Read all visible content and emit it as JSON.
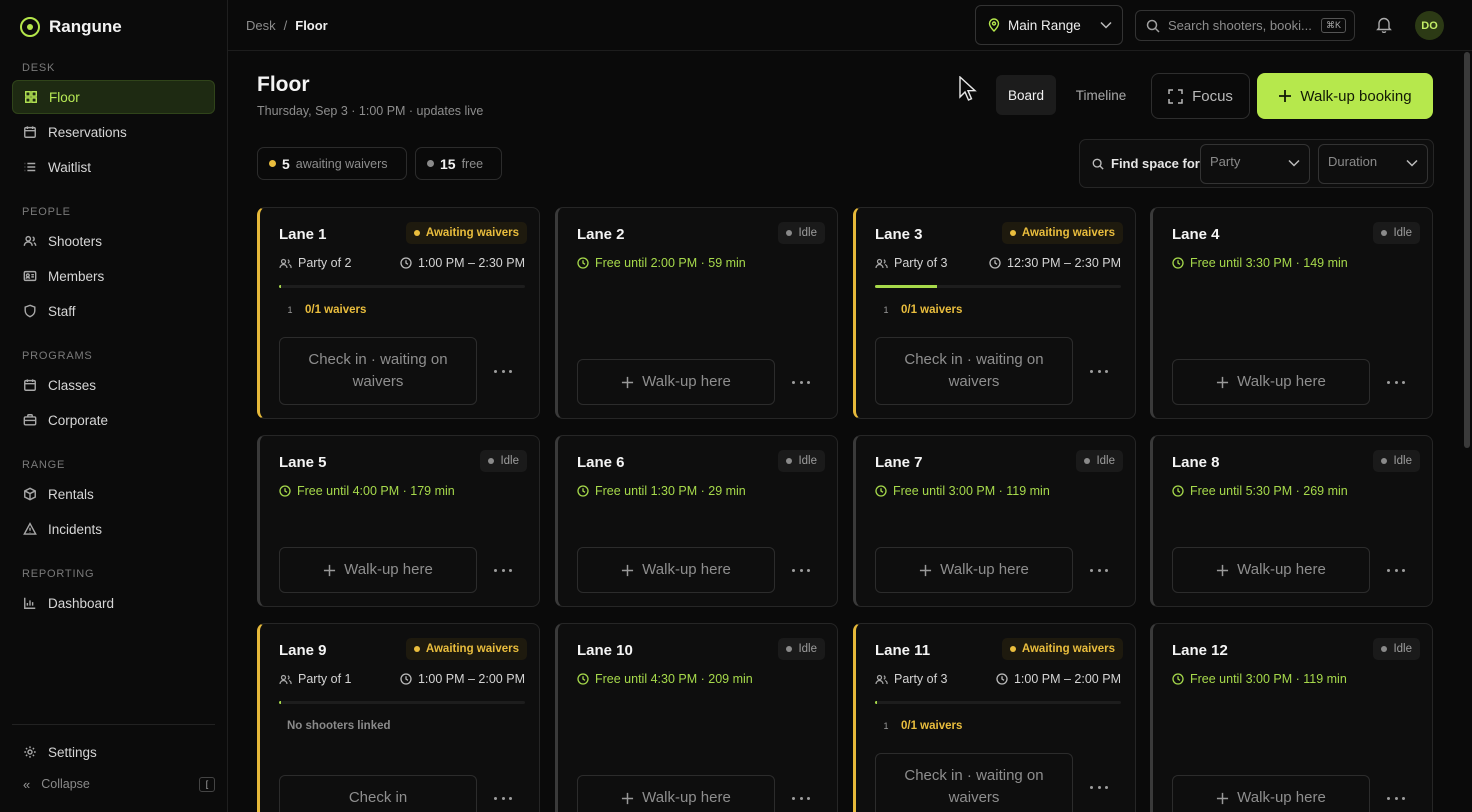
{
  "app": {
    "name": "Rangune"
  },
  "sidebar": {
    "sections": [
      {
        "title": "DESK",
        "items": [
          {
            "label": "Floor",
            "icon": "grid-icon",
            "active": true
          },
          {
            "label": "Reservations",
            "icon": "calendar-icon"
          },
          {
            "label": "Waitlist",
            "icon": "list-icon"
          }
        ]
      },
      {
        "title": "PEOPLE",
        "items": [
          {
            "label": "Shooters",
            "icon": "users-icon"
          },
          {
            "label": "Members",
            "icon": "id-card-icon"
          },
          {
            "label": "Staff",
            "icon": "shield-icon"
          }
        ]
      },
      {
        "title": "PROGRAMS",
        "items": [
          {
            "label": "Classes",
            "icon": "calendar-icon"
          },
          {
            "label": "Corporate",
            "icon": "briefcase-icon"
          }
        ]
      },
      {
        "title": "RANGE",
        "items": [
          {
            "label": "Rentals",
            "icon": "box-icon"
          },
          {
            "label": "Incidents",
            "icon": "warning-icon"
          }
        ]
      },
      {
        "title": "REPORTING",
        "items": [
          {
            "label": "Dashboard",
            "icon": "bar-chart-icon"
          }
        ]
      }
    ],
    "settings_label": "Settings",
    "collapse_label": "Collapse",
    "collapse_key": "["
  },
  "topbar": {
    "breadcrumb": [
      "Desk",
      "Floor"
    ],
    "breadcrumb_sep": "/",
    "range": "Main Range",
    "search_placeholder": "Search shooters, booki...",
    "search_kbd": "⌘K",
    "avatar_initials": "DO"
  },
  "page": {
    "title": "Floor",
    "subtitle": "Thursday, Sep 3 · 1:00 PM · updates live",
    "view_board": "Board",
    "view_timeline": "Timeline",
    "focus_label": "Focus",
    "walkup_label": "Walk-up booking"
  },
  "summary": {
    "awaiting_count": "5",
    "awaiting_label": "awaiting waivers",
    "free_count": "15",
    "free_label": "free"
  },
  "find": {
    "label": "Find space for",
    "party_placeholder": "Party",
    "duration_placeholder": "Duration"
  },
  "colors": {
    "accent": "#b6e84c",
    "warning": "#e9bd3d",
    "free": "#a6d94b"
  },
  "lanes": [
    {
      "name": "Lane 1",
      "status": "Awaiting waivers",
      "party": "Party of 2",
      "time": "1:00 PM – 2:30 PM",
      "progress": 0.01,
      "waiver_num": "1",
      "waivers": "0/1 waivers",
      "action": "Check in · waiting on waivers"
    },
    {
      "name": "Lane 2",
      "status": "Idle",
      "free": "Free until 2:00 PM · 59 min",
      "action": "Walk-up here"
    },
    {
      "name": "Lane 3",
      "status": "Awaiting waivers",
      "party": "Party of 3",
      "time": "12:30 PM – 2:30 PM",
      "progress": 0.25,
      "waiver_num": "1",
      "waivers": "0/1 waivers",
      "action": "Check in · waiting on waivers"
    },
    {
      "name": "Lane 4",
      "status": "Idle",
      "free": "Free until 3:30 PM · 149 min",
      "action": "Walk-up here"
    },
    {
      "name": "Lane 5",
      "status": "Idle",
      "free": "Free until 4:00 PM · 179 min",
      "action": "Walk-up here"
    },
    {
      "name": "Lane 6",
      "status": "Idle",
      "free": "Free until 1:30 PM · 29 min",
      "action": "Walk-up here"
    },
    {
      "name": "Lane 7",
      "status": "Idle",
      "free": "Free until 3:00 PM · 119 min",
      "action": "Walk-up here"
    },
    {
      "name": "Lane 8",
      "status": "Idle",
      "free": "Free until 5:30 PM · 269 min",
      "action": "Walk-up here"
    },
    {
      "name": "Lane 9",
      "status": "Awaiting waivers",
      "party": "Party of 1",
      "time": "1:00 PM – 2:00 PM",
      "progress": 0.01,
      "note": "No shooters linked",
      "action": "Check in"
    },
    {
      "name": "Lane 10",
      "status": "Idle",
      "free": "Free until 4:30 PM · 209 min",
      "action": "Walk-up here"
    },
    {
      "name": "Lane 11",
      "status": "Awaiting waivers",
      "party": "Party of 3",
      "time": "1:00 PM – 2:00 PM",
      "progress": 0.01,
      "waiver_num": "1",
      "waivers": "0/1 waivers",
      "action": "Check in · waiting on waivers"
    },
    {
      "name": "Lane 12",
      "status": "Idle",
      "free": "Free until 3:00 PM · 119 min",
      "action": "Walk-up here"
    }
  ]
}
